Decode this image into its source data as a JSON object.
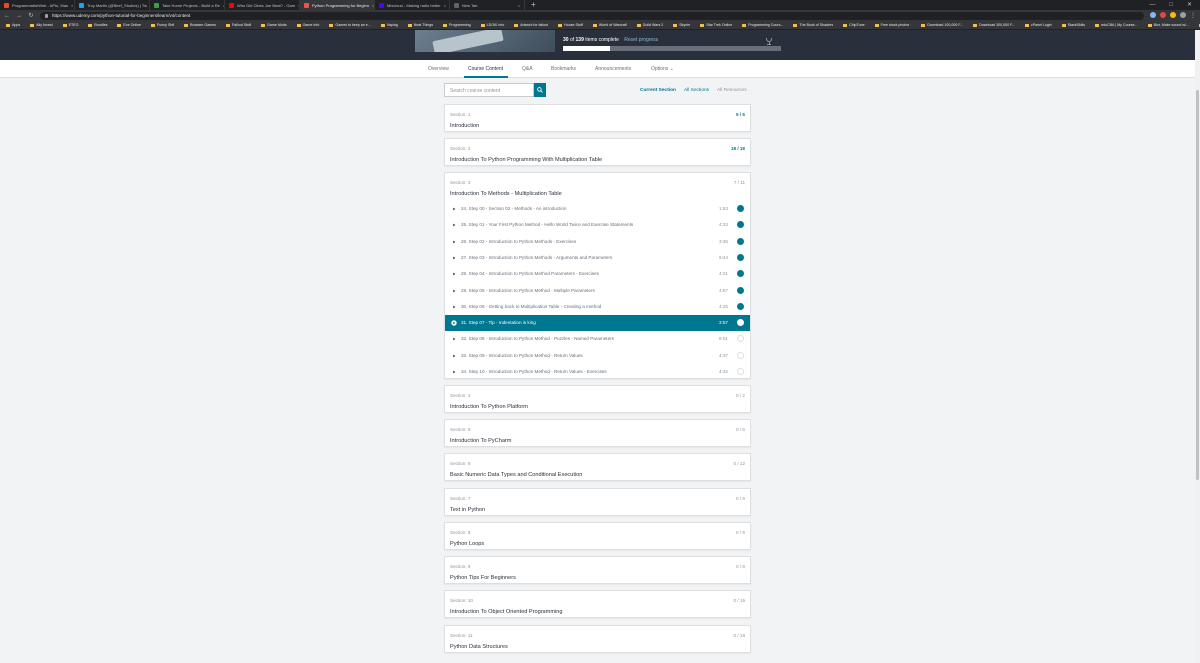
{
  "browser": {
    "tabs": [
      {
        "label": "ProgrammableWeb - APIs, Mas",
        "color": "#e34c26"
      },
      {
        "label": "Troy Martin (@Beef_Studios) | Tw",
        "color": "#1da1f2"
      },
      {
        "label": "Take Home Projects - Build a Re",
        "color": "#3c9e4a"
      },
      {
        "label": "Who Did Cibes Joe Beat? - Gam",
        "color": "#ff0000"
      },
      {
        "label": "Python Programming for Beginn",
        "color": "#ec5252"
      },
      {
        "label": "Mixcloud - Making radio better",
        "color": "#5000ff"
      },
      {
        "label": "New Tab",
        "color": "#5f6368"
      }
    ],
    "active_tab": 4,
    "url": "https://www.udemy.com/python-tutorial-for-beginners/learn/v4/content",
    "bookmarks": [
      "Apps",
      "Ally Invest",
      "ETEO",
      "Bundles",
      "Eve Online",
      "Funny Shit",
      "Browser Games",
      "Fallout Stuff",
      "Game Mods",
      "Game Info",
      "Games to keep an e...",
      "Vaping",
      "Neat Things",
      "Programming",
      "LDOKI info",
      "Artwork for fallout",
      "House Stuff",
      "World of Warcraft",
      "Guild Wars 2",
      "Skyrim",
      "Star Trek Online",
      "Programming Cours...",
      "The Book of Shaders",
      "ChipTune",
      "Free stock photos ·",
      "Download 100,000 F...",
      "Download 300,000 F...",
      "cPanel Login",
      "StackSkills",
      "eduCBA | My Course...",
      "Blur, Make sound wi..."
    ],
    "other_bookmarks": "Other bookmarks"
  },
  "hero": {
    "completed": "30",
    "of_text": "of",
    "total": "139",
    "items_complete": "items complete",
    "reset_label": "Reset progress",
    "progress_fraction": 0.2158
  },
  "course_nav": [
    {
      "label": "Overview"
    },
    {
      "label": "Course Content"
    },
    {
      "label": "Q&A"
    },
    {
      "label": "Bookmarks"
    },
    {
      "label": "Announcements"
    },
    {
      "label": "Options ⌄"
    }
  ],
  "search": {
    "placeholder": "Search course content"
  },
  "filters": {
    "current": "Current Section",
    "all": "All Sections",
    "resources": "All Resources"
  },
  "sections": [
    {
      "num": "Section: 1",
      "title": "Introduction",
      "count": "5 / 5",
      "done": true
    },
    {
      "num": "Section: 2",
      "title": "Introduction To Python Programming With Multiplication Table",
      "count": "18 / 18",
      "done": true
    },
    {
      "num": "Section: 3",
      "title": "Introduction To Methods - Multiplication Table",
      "count": "7 / 11",
      "done": false
    },
    {
      "num": "Section: 4",
      "title": "Introduction To Python Platform",
      "count": "0 / 2",
      "done": false
    },
    {
      "num": "Section: 5",
      "title": "Introduction To PyCharm",
      "count": "0 / 6",
      "done": false
    },
    {
      "num": "Section: 6",
      "title": "Basic Numeric Data Types and Conditional Execution",
      "count": "0 / 12",
      "done": false
    },
    {
      "num": "Section: 7",
      "title": "Text in Python",
      "count": "0 / 8",
      "done": false
    },
    {
      "num": "Section: 8",
      "title": "Python Loops",
      "count": "0 / 9",
      "done": false
    },
    {
      "num": "Section: 9",
      "title": "Python Tips For Beginners",
      "count": "0 / 8",
      "done": false
    },
    {
      "num": "Section: 10",
      "title": "Introduction To Object Oriented Programming",
      "count": "0 / 15",
      "done": false
    },
    {
      "num": "Section: 11",
      "title": "Python Data Structures",
      "count": "0 / 19",
      "done": false
    }
  ],
  "lectures": [
    {
      "title": "24. Step 00 - Section 02 - Methods - An introduction",
      "duration": "1:53",
      "status": "done"
    },
    {
      "title": "25. Step 01 - Your First Python Method - Hello World Twice and Exercise Statements",
      "duration": "4:33",
      "status": "done"
    },
    {
      "title": "26. Step 02 - Introduction to Python Methods - Exercises",
      "duration": "3:35",
      "status": "done"
    },
    {
      "title": "27. Step 03 - Introduction to Python Methods - Arguments and Parameters",
      "duration": "9:44",
      "status": "done"
    },
    {
      "title": "28. Step 04 - Introduction to Python Method Parameters - Exercises",
      "duration": "4:21",
      "status": "done"
    },
    {
      "title": "29. Step 05 - Introduction to Python Method - Multiple Parameters",
      "duration": "4:57",
      "status": "done"
    },
    {
      "title": "30. Step 06 - Getting back to Multiplication Table - Creating a method",
      "duration": "4:25",
      "status": "done"
    },
    {
      "title": "31. Step 07 - Tip - Indentation is king",
      "duration": "3:57",
      "status": "active"
    },
    {
      "title": "32. Step 08 - Introduction to Python Method - Puzzles - Named Parameters",
      "duration": "8:01",
      "status": "todo"
    },
    {
      "title": "33. Step 09 - Introduction to Python Method - Return Values",
      "duration": "4:37",
      "status": "todo"
    },
    {
      "title": "34. Step 10 - Introduction to Python Method - Return Values - Exercises",
      "duration": "4:32",
      "status": "todo"
    }
  ],
  "colors": {
    "accent": "#007791",
    "hero_bg": "#29303b",
    "check_done": "#007791"
  }
}
